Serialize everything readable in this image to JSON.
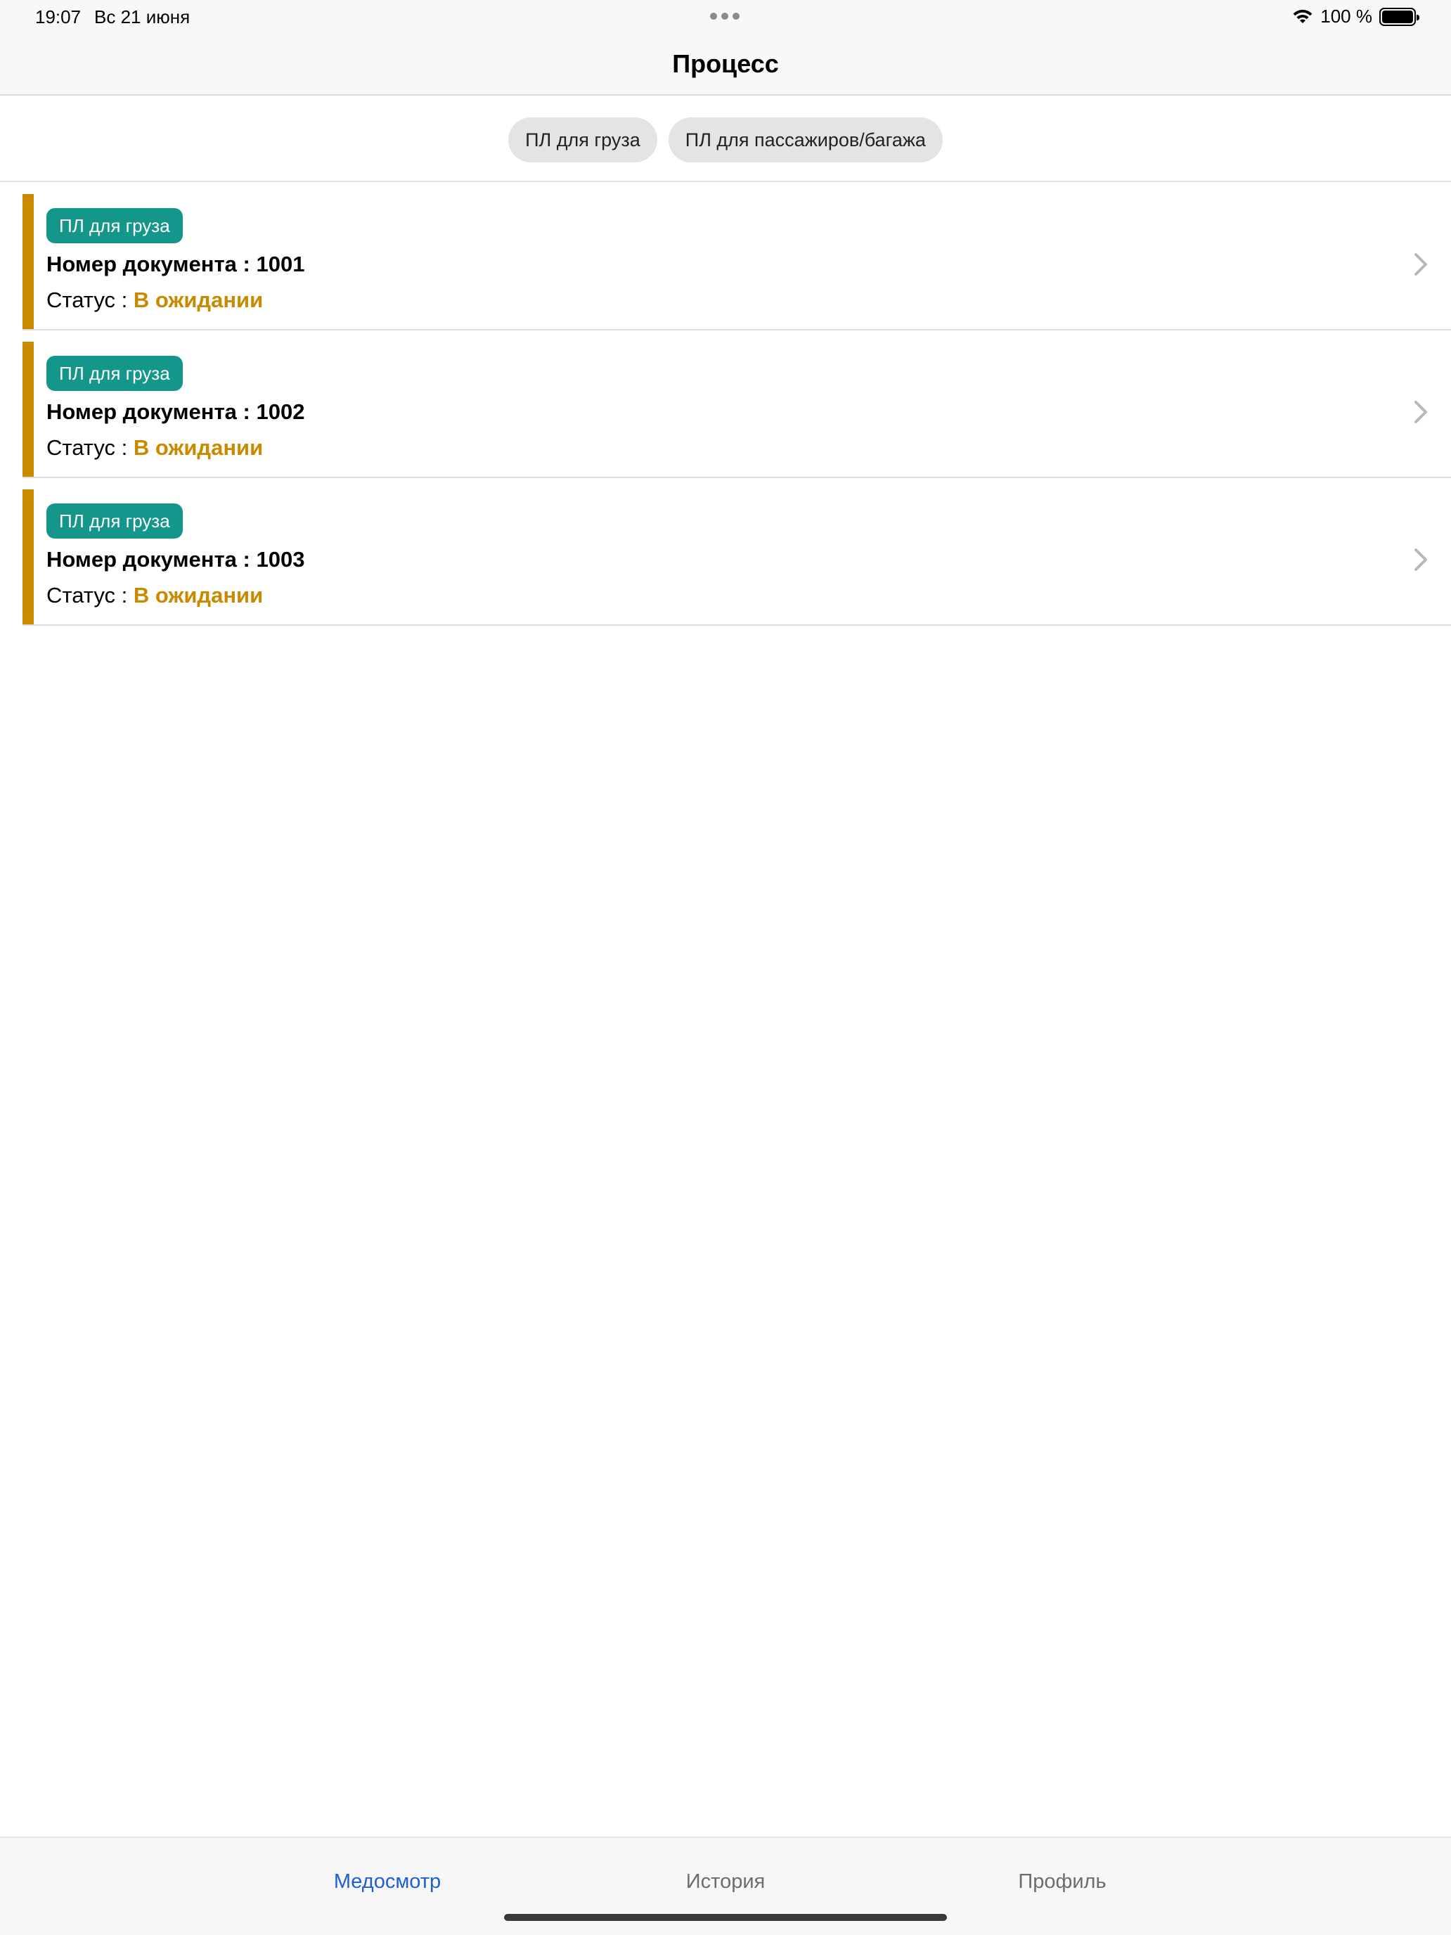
{
  "status_bar": {
    "time": "19:07",
    "date": "Вс 21 июня",
    "battery_text": "100 %"
  },
  "navbar": {
    "title": "Процесс"
  },
  "filters": [
    {
      "label": "ПЛ для груза"
    },
    {
      "label": "ПЛ для пассажиров/багажа"
    }
  ],
  "documents": [
    {
      "tag": "ПЛ для груза",
      "doc_label": "Номер документа : 1001",
      "status_label": "Статус : ",
      "status_value": "В ожидании"
    },
    {
      "tag": "ПЛ для груза",
      "doc_label": "Номер документа : 1002",
      "status_label": "Статус : ",
      "status_value": "В ожидании"
    },
    {
      "tag": "ПЛ для груза",
      "doc_label": "Номер документа : 1003",
      "status_label": "Статус : ",
      "status_value": "В ожидании"
    }
  ],
  "tabs": [
    {
      "label": "Медосмотр",
      "active": true
    },
    {
      "label": "История",
      "active": false
    },
    {
      "label": "Профиль",
      "active": false
    }
  ],
  "colors": {
    "accent_bar": "#c98a00",
    "tag_bg": "#14968a",
    "active_tab": "#1e5fd3"
  }
}
